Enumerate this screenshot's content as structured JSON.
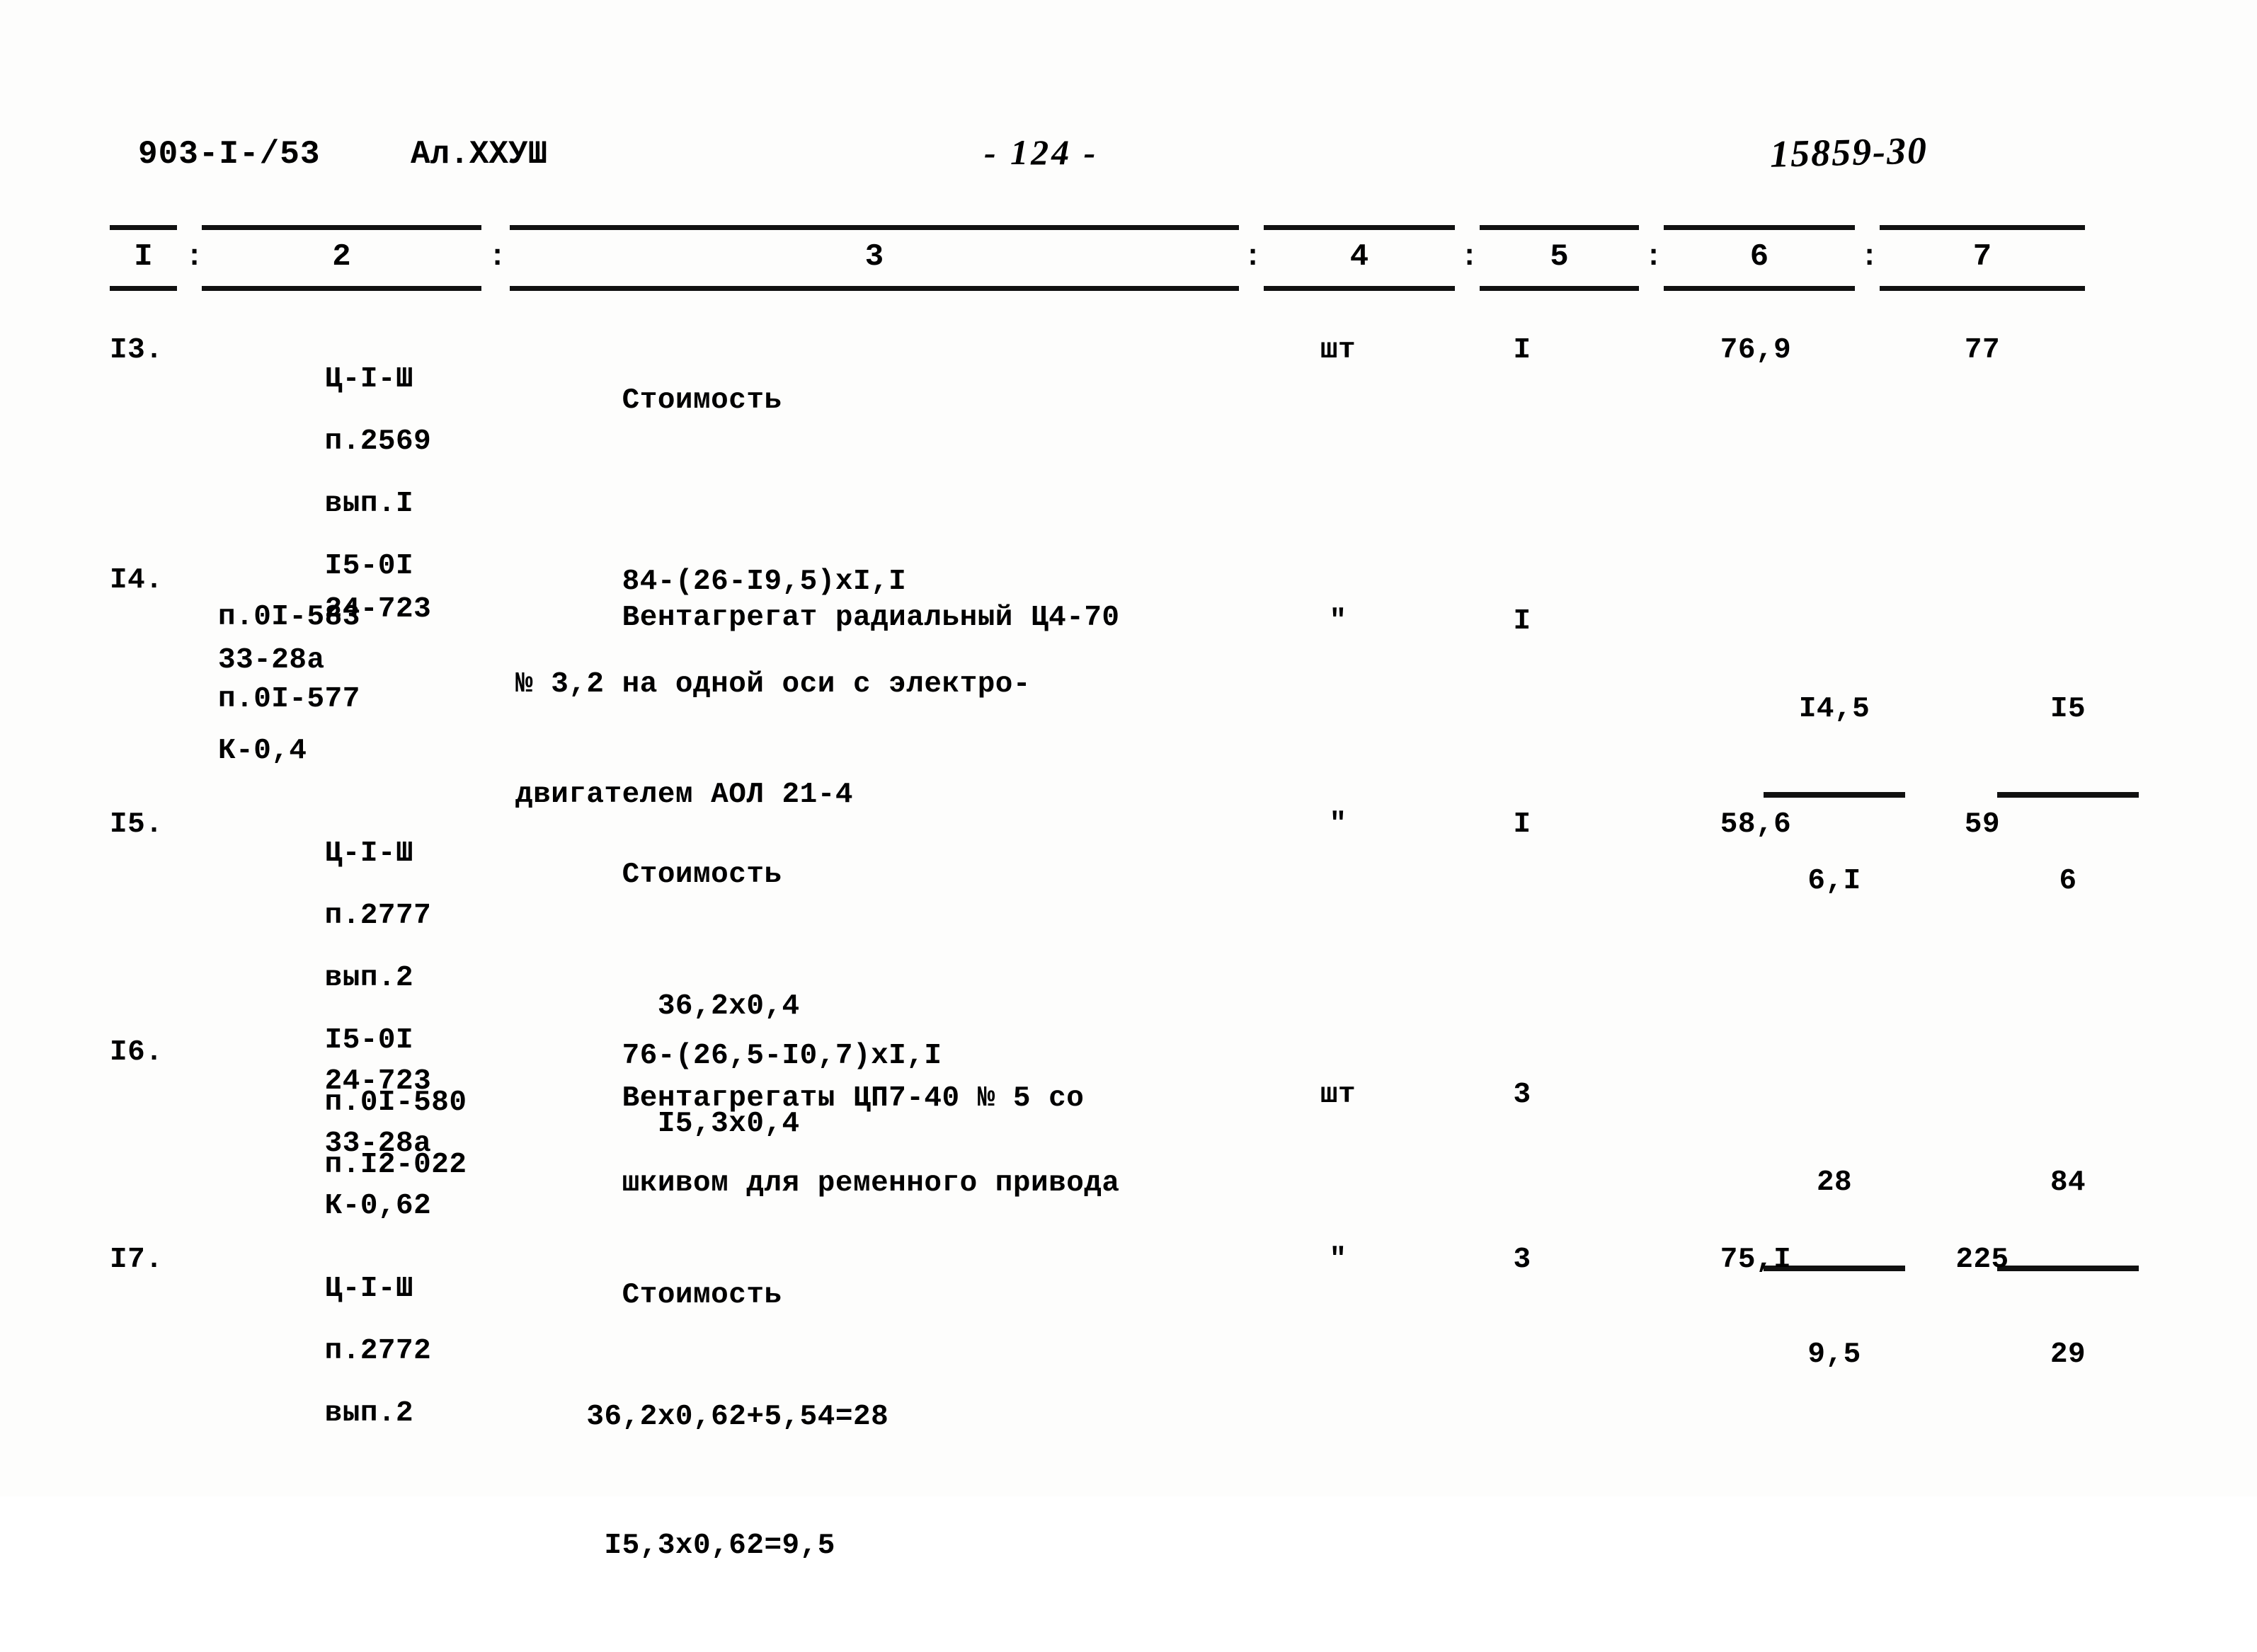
{
  "header": {
    "doc_code": "903-I-/53",
    "album": "Ал.XXУШ",
    "page_number": "- 124 -",
    "stamp_code": "15859-30"
  },
  "table": {
    "column_headers": [
      "I",
      "2",
      "3",
      "4",
      "5",
      "6",
      "7"
    ],
    "separator": ":",
    "rows": [
      {
        "num": "I3.",
        "code_lines": [
          "Ц-I-Ш",
          "п.2569",
          "вып.I",
          "I5-0I",
          "п.0I-583",
          "п.0I-577"
        ],
        "desc_lines": [
          "Стоимость",
          "",
          "84-(26-I9,5)xI,I"
        ],
        "unit": "шт",
        "qty": "I",
        "value": "76,9",
        "value_den": "",
        "total": "77",
        "total_den": ""
      },
      {
        "num": "I4.",
        "code_lines": [
          "24-723",
          "33-28а",
          "К-0,4"
        ],
        "desc_lines": [
          "Вентагрегат радиальный Ц4-70",
          "№ 3,2 на одной оси с электро-",
          "двигателем АОЛ 21-4",
          "",
          "        36,2х0,4",
          "        I5,3х0,4"
        ],
        "unit": "\"",
        "qty": "I",
        "value": "I4,5",
        "value_den": "6,I",
        "total": "I5",
        "total_den": "6"
      },
      {
        "num": "I5.",
        "code_lines": [
          "Ц-I-Ш",
          "п.2777",
          "вып.2",
          "I5-0I",
          "п.0I-580",
          "п.I2-022"
        ],
        "desc_lines": [
          "Стоимость",
          "",
          "76-(26,5-I0,7)xI,I"
        ],
        "unit": "\"",
        "qty": "I",
        "value": "58,6",
        "value_den": "",
        "total": "59",
        "total_den": ""
      },
      {
        "num": "I6.",
        "code_lines": [
          "24-723",
          "33-28а",
          "К-0,62"
        ],
        "desc_lines": [
          "Вентагрегаты ЦП7-40 № 5 со",
          "шкивом для ременного привода",
          "",
          "    36,2х0,62+5,54=28",
          "     I5,3х0,62=9,5"
        ],
        "unit": "шт",
        "qty": "3",
        "value": "28",
        "value_den": "9,5",
        "total": "84",
        "total_den": "29"
      },
      {
        "num": "I7.",
        "code_lines": [
          "Ц-I-Ш",
          "п.2772",
          "вып.2"
        ],
        "desc_lines": [
          "Стоимость"
        ],
        "unit": "\"",
        "qty": "3",
        "value": "75,I",
        "value_den": "",
        "total": "225",
        "total_den": ""
      }
    ]
  }
}
